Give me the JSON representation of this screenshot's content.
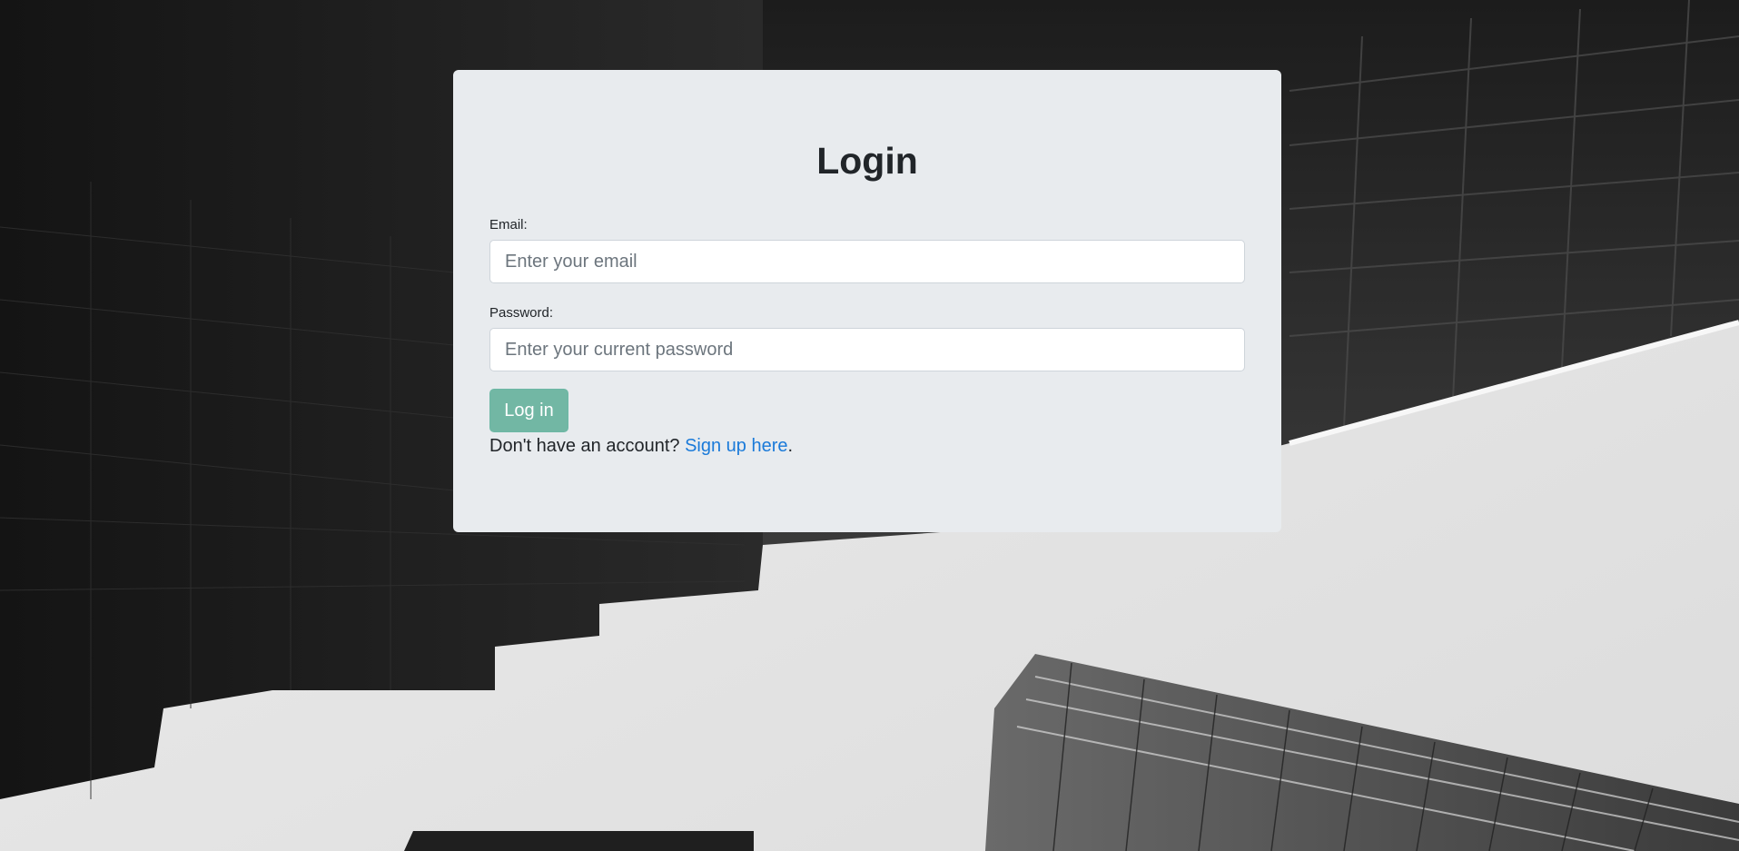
{
  "login": {
    "title": "Login",
    "email_label": "Email:",
    "email_placeholder": "Enter your email",
    "email_value": "",
    "password_label": "Password:",
    "password_placeholder": "Enter your current password",
    "password_value": "",
    "submit_label": "Log in",
    "signup_prompt": "Don't have an account? ",
    "signup_link": "Sign up here",
    "signup_suffix": "."
  },
  "theme": {
    "card_background": "#e8ebee",
    "button_color": "#72b7a4",
    "link_color": "#1a7ad9",
    "text_color": "#212529"
  },
  "background": {
    "image": "monochrome-skyscrapers-photo"
  }
}
